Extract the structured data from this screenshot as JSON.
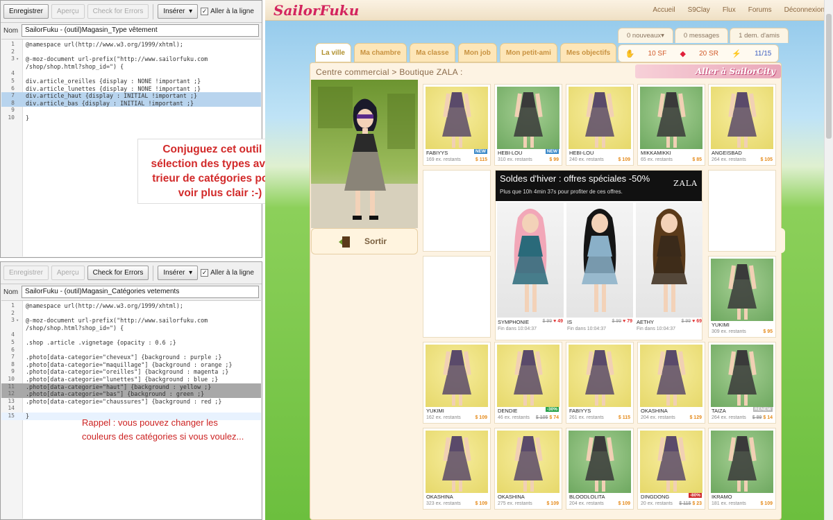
{
  "editor1": {
    "save": "Enregistrer",
    "preview": "Aperçu",
    "check": "Check for Errors",
    "insert": "Insérer",
    "insert_arrow": "▾",
    "wrap_label": "Aller à la ligne",
    "name_label": "Nom",
    "name_value": "SailorFuku - (outil)Magasin_Type vêtement",
    "lines": [
      {
        "n": "1",
        "t": "@namespace url(http://www.w3.org/1999/xhtml);",
        "s": ""
      },
      {
        "n": "2",
        "t": "",
        "s": ""
      },
      {
        "n": "3",
        "t": "@-moz-document url-prefix(\"http://www.sailorfuku.com",
        "s": "",
        "f": "▾"
      },
      {
        "n": "",
        "t": "/shop/shop.html?shop_id=\") {",
        "s": ""
      },
      {
        "n": "4",
        "t": "",
        "s": ""
      },
      {
        "n": "5",
        "t": "div.article_oreilles {display : NONE !important ;}",
        "s": ""
      },
      {
        "n": "6",
        "t": "div.article_lunettes {display : NONE !important ;}",
        "s": ""
      },
      {
        "n": "7",
        "t": "div.article_haut {display : INITIAL !important ;}",
        "s": "hl"
      },
      {
        "n": "8",
        "t": "div.article_bas {display : INITIAL !important ;}",
        "s": "hl"
      },
      {
        "n": "9",
        "t": "",
        "s": ""
      },
      {
        "n": "10",
        "t": "}",
        "s": ""
      }
    ]
  },
  "editor2": {
    "save": "Enregistrer",
    "preview": "Aperçu",
    "check": "Check for Errors",
    "insert": "Insérer",
    "insert_arrow": "▾",
    "wrap_label": "Aller à la ligne",
    "name_label": "Nom",
    "name_value": "SailorFuku - (outil)Magasin_Catégories vetements",
    "lines": [
      {
        "n": "1",
        "t": "@namespace url(http://www.w3.org/1999/xhtml);",
        "s": ""
      },
      {
        "n": "2",
        "t": "",
        "s": ""
      },
      {
        "n": "3",
        "t": "@-moz-document url-prefix(\"http://www.sailorfuku.com",
        "s": "",
        "f": "▾"
      },
      {
        "n": "",
        "t": "/shop/shop.html?shop_id=\") {",
        "s": ""
      },
      {
        "n": "4",
        "t": "",
        "s": ""
      },
      {
        "n": "5",
        "t": ".shop .article .vignetage {opacity : 0.6 ;}",
        "s": ""
      },
      {
        "n": "6",
        "t": "",
        "s": ""
      },
      {
        "n": "7",
        "t": ".photo[data-categorie=\"cheveux\"] {background : purple ;}",
        "s": ""
      },
      {
        "n": "8",
        "t": ".photo[data-categorie=\"maquillage\"] {background : orange ;}",
        "s": ""
      },
      {
        "n": "9",
        "t": ".photo[data-categorie=\"oreilles\"] {background : magenta ;}",
        "s": ""
      },
      {
        "n": "10",
        "t": ".photo[data-categorie=\"lunettes\"] {background : blue ;}",
        "s": ""
      },
      {
        "n": "11",
        "t": ".photo[data-categorie=\"haut\"] {background : yellow ;}",
        "s": "hlg"
      },
      {
        "n": "12",
        "t": ".photo[data-categorie=\"bas\"] {background : green ;}",
        "s": "hlg"
      },
      {
        "n": "13",
        "t": ".photo[data-categorie=\"chaussures\"] {background : red ;}",
        "s": ""
      },
      {
        "n": "14",
        "t": "",
        "s": ""
      },
      {
        "n": "15",
        "t": "}",
        "s": "cur"
      }
    ]
  },
  "annotations": {
    "top": "Conjuguez cet outil de sélection des types avec le trieur de catégories pour y voir plus clair :-)",
    "bottom": "Rappel : vous pouvez changer les couleurs des catégories si vous voulez..."
  },
  "site": {
    "logo": "SailorFuku",
    "nav": [
      "Accueil",
      "S9Clay",
      "Flux",
      "Forums",
      "Déconnexion"
    ],
    "notifications": [
      "0 nouveaux▾",
      "0 messages",
      "1 dem. d'amis"
    ],
    "tabs": [
      "La ville",
      "Ma chambre",
      "Ma classe",
      "Mon job",
      "Mon petit-ami",
      "Mes objectifs"
    ],
    "stats": {
      "sf": "10 SF",
      "sr": "20 SR",
      "energy": "11/15"
    },
    "breadcrumb": "Centre commercial > Boutique ZALA :",
    "city_banner": "Aller à SailorCity",
    "exit_label": "Sortir",
    "colors": {
      "brand": "#d3245e",
      "price": "#e58a1a",
      "new_badge": "#3a88c8",
      "discount_badge": "#2aa24a",
      "sale_badge": "#d02a2a"
    }
  },
  "promo": {
    "title": "Soldes d'hiver : offres spéciales -50%",
    "subtitle": "Plus que 10h 4min 37s pour profiter de ces offres.",
    "brand": "ZALA",
    "items": [
      {
        "name": "SYMPHONIE",
        "old": "$ 99",
        "price": "49",
        "ends": "Fin dans 10:04:37"
      },
      {
        "name": "IS",
        "old": "$ 99",
        "price": "79",
        "ends": "Fin dans 10:04:37"
      },
      {
        "name": "AETHY",
        "old": "$ 99",
        "price": "69",
        "ends": "Fin dans 10:04:37"
      }
    ]
  },
  "products": [
    {
      "name": "FABIYYS",
      "stock": "169 ex. restants",
      "price": "$ 115",
      "badge": "NEW",
      "bg": "y"
    },
    {
      "name": "HEBI-LOU",
      "stock": "310 ex. restants",
      "price": "$ 99",
      "badge": "NEW",
      "bg": "g"
    },
    {
      "name": "HEBI-LOU",
      "stock": "240 ex. restants",
      "price": "$ 109",
      "badge": "",
      "bg": "y"
    },
    {
      "name": "MIKKAMIKKI",
      "stock": "65 ex. restants",
      "price": "$ 85",
      "badge": "",
      "bg": "g"
    },
    {
      "name": "ANGEISBAD",
      "stock": "264 ex. restants",
      "price": "$ 105",
      "badge": "",
      "bg": "y"
    },
    {
      "name": "YUKIMI",
      "stock": "309 ex. restants",
      "price": "$ 95",
      "badge": "",
      "bg": "g"
    },
    {
      "name": "YUKIMI",
      "stock": "162 ex. restants",
      "price": "$ 109",
      "badge": "",
      "bg": "y"
    },
    {
      "name": "DENDIE",
      "stock": "46 ex. restants",
      "price": "$ 74",
      "old": "$ 105",
      "badge": "-30%",
      "bg": "y"
    },
    {
      "name": "FABIYYS",
      "stock": "261 ex. restants",
      "price": "$ 115",
      "badge": "",
      "bg": "y"
    },
    {
      "name": "OKASHINA",
      "stock": "204 ex. restants",
      "price": "$ 129",
      "badge": "",
      "bg": "y"
    },
    {
      "name": "TAIZA",
      "stock": "264 ex. restants",
      "price": "$ 14",
      "old": "$ 89",
      "badge": "RENEW",
      "bg": "g"
    },
    {
      "name": "OKASHINA",
      "stock": "323 ex. restants",
      "price": "$ 109",
      "badge": "",
      "bg": "y"
    },
    {
      "name": "OKASHINA",
      "stock": "275 ex. restants",
      "price": "$ 109",
      "badge": "",
      "bg": "y"
    },
    {
      "name": "BLOODLOLITA",
      "stock": "204 ex. restants",
      "price": "$ 109",
      "badge": "",
      "bg": "g"
    },
    {
      "name": "DINGDONG",
      "stock": "20 ex. restants",
      "price": "$ 23",
      "old": "$ 115",
      "badge": "-80%",
      "bg": "y"
    },
    {
      "name": "IKRAMO",
      "stock": "181 ex. restants",
      "price": "$ 109",
      "badge": "",
      "bg": "g"
    }
  ]
}
